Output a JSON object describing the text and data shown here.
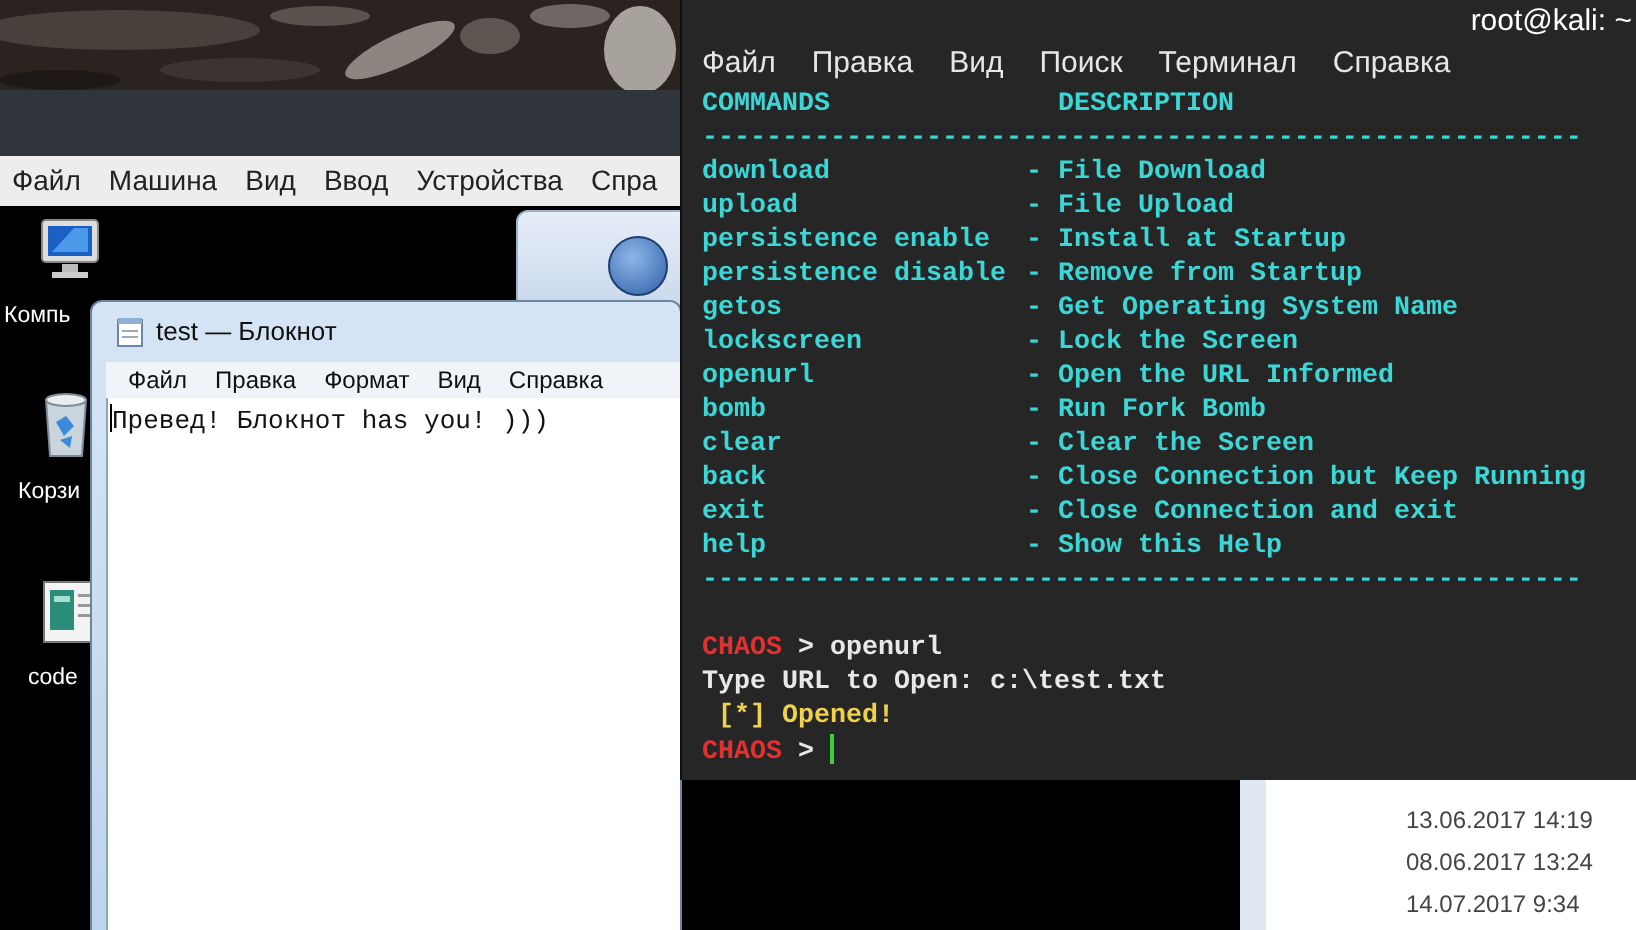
{
  "virtualbox": {
    "menu": [
      "Файл",
      "Машина",
      "Вид",
      "Ввод",
      "Устройства",
      "Спра"
    ]
  },
  "vm_desktop": {
    "icons": [
      {
        "kind": "computer",
        "label": "Компь"
      },
      {
        "kind": "trash",
        "label": "Корзи"
      },
      {
        "kind": "document",
        "label": "code"
      }
    ]
  },
  "notepad": {
    "title": "test — Блокнот",
    "menu": [
      "Файл",
      "Правка",
      "Формат",
      "Вид",
      "Справка"
    ],
    "text": "Превед! Блокнот has you! )))"
  },
  "explorer": {
    "dates": [
      "13.06.2017 14:19",
      "08.06.2017 13:24",
      "14.07.2017 9:34"
    ]
  },
  "terminal": {
    "title": "root@kali: ~",
    "menu": [
      "Файл",
      "Правка",
      "Вид",
      "Поиск",
      "Терминал",
      "Справка"
    ],
    "help_header": {
      "commands": "COMMANDS",
      "description": "DESCRIPTION"
    },
    "rule_top": "-------------------------------------------------------",
    "commands": [
      {
        "name": "download",
        "description": "- File Download"
      },
      {
        "name": "upload",
        "description": "- File Upload"
      },
      {
        "name": "persistence enable",
        "description": "- Install at Startup"
      },
      {
        "name": "persistence disable",
        "description": "- Remove from Startup"
      },
      {
        "name": "getos",
        "description": "- Get Operating System Name"
      },
      {
        "name": "lockscreen",
        "description": "- Lock the Screen"
      },
      {
        "name": "openurl",
        "description": "- Open the URL Informed"
      },
      {
        "name": "bomb",
        "description": "- Run Fork Bomb"
      },
      {
        "name": "clear",
        "description": "- Clear the Screen"
      },
      {
        "name": "back",
        "description": "- Close Connection but Keep Running"
      },
      {
        "name": "exit",
        "description": "- Close Connection and exit"
      },
      {
        "name": "help",
        "description": "- Show this Help"
      }
    ],
    "rule_bottom": "-------------------------------------------------------",
    "session": [
      {
        "kind": "prompt",
        "prompt": "CHAOS",
        "symbol": ">",
        "input": "openurl"
      },
      {
        "kind": "output",
        "text": "Type URL to Open: c:\\test.txt"
      },
      {
        "kind": "status",
        "text": "[*] Opened!"
      },
      {
        "kind": "prompt",
        "prompt": "CHAOS",
        "symbol": ">",
        "cursor": true
      }
    ]
  }
}
